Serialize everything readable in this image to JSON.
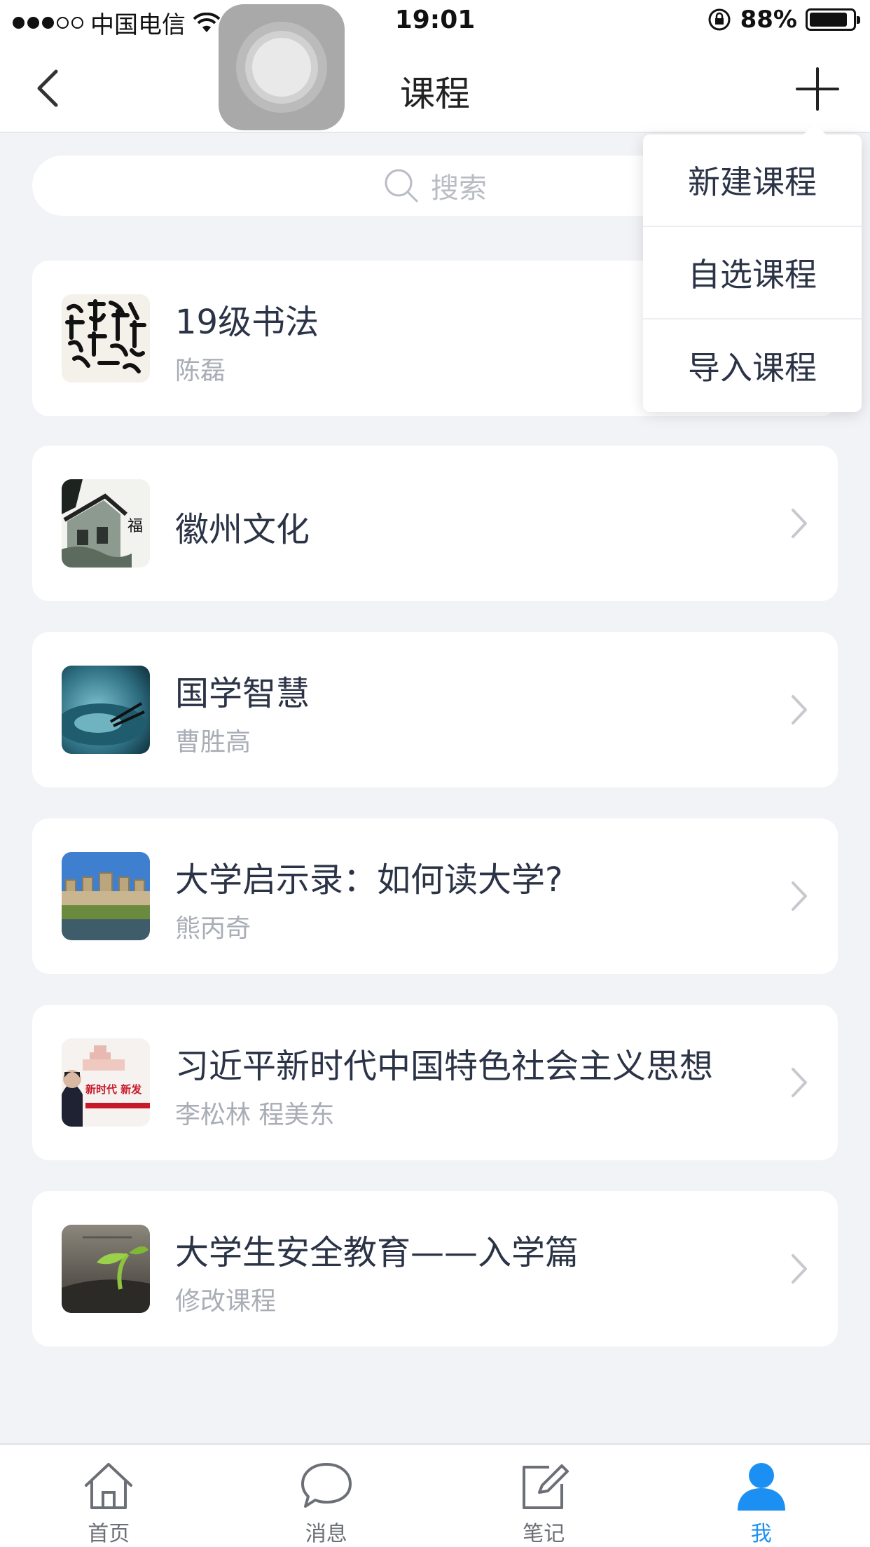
{
  "status_bar": {
    "carrier": "中国电信",
    "time": "19:01",
    "battery": "88%",
    "battery_level": 0.88
  },
  "nav": {
    "title": "课程"
  },
  "search": {
    "placeholder": "搜索"
  },
  "dropdown": {
    "items": [
      {
        "label": "新建课程"
      },
      {
        "label": "自选课程"
      },
      {
        "label": "导入课程"
      }
    ]
  },
  "courses": [
    {
      "title": "19级书法",
      "teacher": "陈磊",
      "thumb": "calligraphy-thumb"
    },
    {
      "title": "徽州文化",
      "teacher": "",
      "thumb": "huizhou-thumb"
    },
    {
      "title": "国学智慧",
      "teacher": "曹胜高",
      "thumb": "guoxue-thumb"
    },
    {
      "title": "大学启示录：如何读大学?",
      "teacher": "熊丙奇",
      "thumb": "university-thumb"
    },
    {
      "title": "习近平新时代中国特色社会主义思想",
      "teacher": "李松林 程美东",
      "thumb": "new-era-thumb",
      "thumb_text": "新时代 新发"
    },
    {
      "title": "大学生安全教育——入学篇",
      "teacher": "修改课程",
      "thumb": "safety-thumb"
    }
  ],
  "tab_bar": {
    "items": [
      {
        "label": "首页",
        "icon": "home-icon"
      },
      {
        "label": "消息",
        "icon": "message-icon"
      },
      {
        "label": "笔记",
        "icon": "note-icon"
      },
      {
        "label": "我",
        "icon": "profile-icon",
        "active": true
      }
    ],
    "active_color": "#1c8ff2"
  }
}
